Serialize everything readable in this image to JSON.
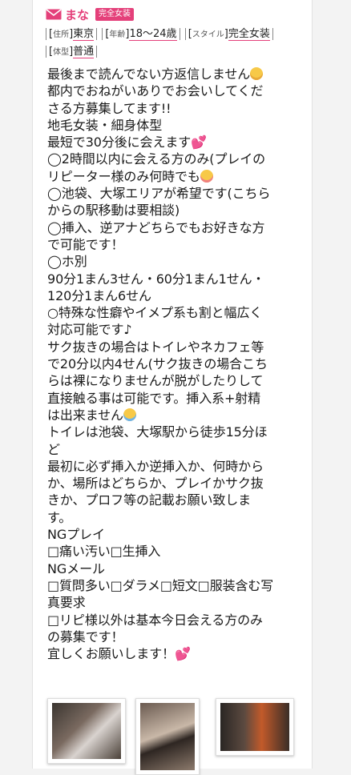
{
  "profile": {
    "name": "まな",
    "badge": "完全女装",
    "attributes": [
      {
        "label": "住所",
        "value": "東京"
      },
      {
        "label": "年齢",
        "value": "18〜24歳"
      },
      {
        "label": "スタイル",
        "value": "完全女装"
      },
      {
        "label": "体型",
        "value": "普通"
      }
    ]
  },
  "message": {
    "lines": [
      "最後まで読んでない方返信しません",
      "都内でおねがいありでお会いしてくだ",
      "さる方募集してます!!",
      "地毛女装・細身体型",
      "最短で30分後に会えます",
      "◯2時間以内に会える方のみ(プレイの",
      "リピーター様のみ何時でも",
      "◯池袋、大塚エリアが希望です(こちら",
      "からの駅移動は要相談)",
      "◯挿入、逆アナどちらでもお好きな方",
      "で可能です！",
      "◯ホ別",
      "90分1まん3せん・60分1まん1せん・",
      "120分1まん6せん",
      "○特殊な性癖やイメプ系も割と幅広く",
      "対応可能です♪",
      "サク抜きの場合はトイレやネカフェ等",
      "で20分以内4せん(サク抜きの場合こち",
      "らは裸になりませんが脱がしたりして",
      "直接触る事は可能です。挿入系+射精",
      "は出来ません",
      "トイレは池袋、大塚駅から徒歩15分ほ",
      "ど",
      "最初に必ず挿入か逆挿入か、何時から",
      "か、場所はどちらか、プレイかサク抜",
      "きか、プロフ等の記載お願い致しま",
      "す。",
      "NGプレイ",
      "□痛い汚い□生挿入",
      "NGメール",
      "□質問多い□ダラメ□短文□服装含む写",
      "真要求",
      "□リピ様以外は基本今日会える方のみ",
      "の募集です！",
      "宜しくお願いします！"
    ]
  },
  "emojis": {
    "pleading": "pleading-face-emoji",
    "heart": "sparkling-heart-emoji",
    "smiling": "smiling-hearts-face-emoji",
    "crying": "crying-face-emoji"
  },
  "photos": [
    {
      "name": "profile-photo-1"
    },
    {
      "name": "profile-photo-2"
    },
    {
      "name": "profile-photo-3"
    }
  ],
  "colors": {
    "accent": "#e4407a",
    "background": "#f3f3f3",
    "card": "#ffffff"
  }
}
